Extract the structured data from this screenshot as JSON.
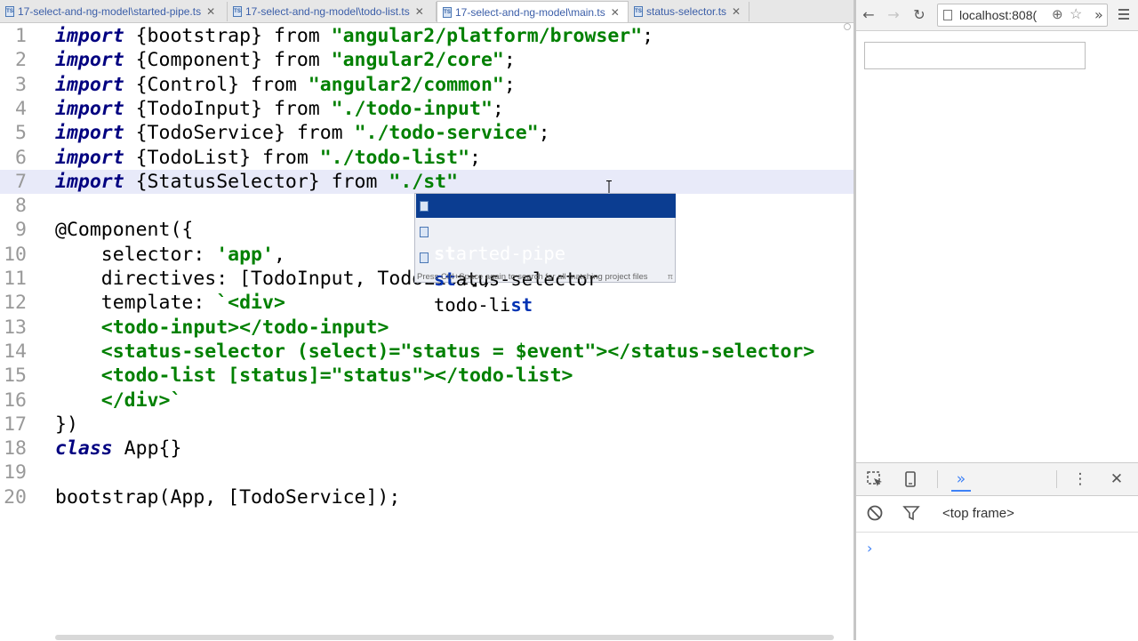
{
  "editor": {
    "tabs": [
      {
        "label": "17-select-and-ng-model\\started-pipe.ts",
        "active": false
      },
      {
        "label": "17-select-and-ng-model\\todo-list.ts",
        "active": false
      },
      {
        "label": "17-select-and-ng-model\\main.ts",
        "active": true
      },
      {
        "label": "status-selector.ts",
        "active": false
      }
    ],
    "lines": [
      {
        "n": "1",
        "html": "<span class=\"kw\">import</span> {bootstrap} from <span class=\"str\">\"angular2/platform/browser\"</span>;"
      },
      {
        "n": "2",
        "html": "<span class=\"kw\">import</span> {Component} from <span class=\"str\">\"angular2/core\"</span>;"
      },
      {
        "n": "3",
        "html": "<span class=\"kw\">import</span> {Control} from <span class=\"str\">\"angular2/common\"</span>;"
      },
      {
        "n": "4",
        "html": "<span class=\"kw\">import</span> {TodoInput} from <span class=\"str\">\"./todo-input\"</span>;"
      },
      {
        "n": "5",
        "html": "<span class=\"kw\">import</span> {TodoService} from <span class=\"str\">\"./todo-service\"</span>;"
      },
      {
        "n": "6",
        "html": "<span class=\"kw\">import</span> {TodoList} from <span class=\"str\">\"./todo-list\"</span>;"
      },
      {
        "n": "7",
        "html": "<span class=\"kw\">import</span> {StatusSelector} from <span class=\"str\">\"./st\"</span>",
        "current": true
      },
      {
        "n": "8",
        "html": ""
      },
      {
        "n": "9",
        "html": "@Component({"
      },
      {
        "n": "10",
        "html": "    selector: <span class=\"str\">'app'</span>,"
      },
      {
        "n": "11",
        "html": "    directives: [TodoInput, TodoList],"
      },
      {
        "n": "12",
        "html": "    template: <span class=\"tmpl\">`&lt;div&gt;</span>"
      },
      {
        "n": "13",
        "html": "    <span class=\"tmpl\">&lt;todo-input&gt;&lt;/todo-input&gt;</span>"
      },
      {
        "n": "14",
        "html": "    <span class=\"tmpl\">&lt;status-selector (select)=\"status = $event\"&gt;&lt;/status-selector&gt;</span>"
      },
      {
        "n": "15",
        "html": "    <span class=\"tmpl\">&lt;todo-list [status]=\"status\"&gt;&lt;/todo-list&gt;</span>"
      },
      {
        "n": "16",
        "html": "    <span class=\"tmpl\">&lt;/div&gt;`</span>"
      },
      {
        "n": "17",
        "html": "})"
      },
      {
        "n": "18",
        "html": "<span class=\"kw\">class</span> App{}"
      },
      {
        "n": "19",
        "html": ""
      },
      {
        "n": "20",
        "html": "bootstrap(App, [TodoService]);"
      }
    ],
    "completion": {
      "items": [
        {
          "prefix": "st",
          "rest": "arted-pipe",
          "selected": true
        },
        {
          "prefix": "st",
          "rest": "atus-selector",
          "selected": false
        },
        {
          "prefix": "todo-li",
          "rest": "st",
          "selected": false,
          "suffix_match": true
        }
      ],
      "hint": "Press Ctrl+Space again to search for all matching project files",
      "pi": "π"
    }
  },
  "browser": {
    "url": "localhost:808(",
    "devtools": {
      "frame_label": "<top frame>"
    }
  },
  "colors": {
    "keyword": "#000080",
    "string": "#008000",
    "selection": "#0b3d91",
    "current_line": "#e8eaf9"
  }
}
